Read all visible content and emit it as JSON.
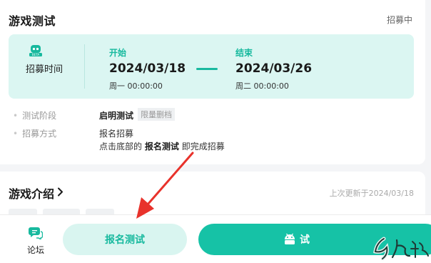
{
  "test_card": {
    "title": "游戏测试",
    "status": "招募中",
    "recruit_time_label": "招募时间",
    "start": {
      "label": "开始",
      "date": "2024/03/18",
      "time": "周一 00:00:00"
    },
    "end": {
      "label": "结束",
      "date": "2024/03/26",
      "time": "周二 00:00:00"
    },
    "stage": {
      "key": "测试阶段",
      "value": "启明测试",
      "tag": "限量删档"
    },
    "method": {
      "key": "招募方式",
      "value": "报名招募",
      "desc_prefix": "点击底部的",
      "desc_bold": "报名测试",
      "desc_suffix": "即完成招募"
    }
  },
  "intro_card": {
    "title": "游戏介绍",
    "last_update": "上次更新于2024/03/18"
  },
  "bottom_bar": {
    "forum_label": "论坛",
    "signup_label": "报名测试",
    "download_label": "试"
  },
  "colors": {
    "accent": "#17b99e",
    "accent_light": "#dbf6f2",
    "annotation": "#e8322b"
  },
  "icons": [
    "beta-icon",
    "chevron-right-icon",
    "forum-icon",
    "android-icon",
    "watermark-logo"
  ]
}
